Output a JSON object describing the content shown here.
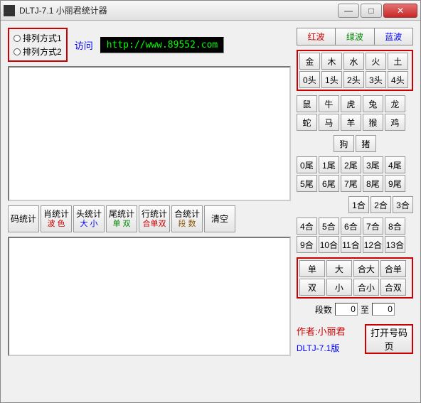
{
  "title": "DLTJ-7.1 小丽君统计器",
  "radios": {
    "opt1": "排列方式1",
    "opt2": "排列方式2"
  },
  "visit": "访问",
  "url": "http://www.89552.com",
  "stats": {
    "ma": "码统计",
    "xiao": {
      "t": "肖统计",
      "b": "波 色"
    },
    "tou": {
      "t": "头统计",
      "b": "大 小"
    },
    "wei": {
      "t": "尾统计",
      "b": "单 双"
    },
    "hang": {
      "t": "行统计",
      "b": "合单双"
    },
    "he": {
      "t": "合统计",
      "b": "段 数"
    },
    "clear": "清空"
  },
  "waves": {
    "red": "红波",
    "green": "绿波",
    "blue": "蓝波"
  },
  "elements": [
    "金",
    "木",
    "水",
    "火",
    "土"
  ],
  "heads": [
    "0头",
    "1头",
    "2头",
    "3头",
    "4头"
  ],
  "zodiac": [
    "鼠",
    "牛",
    "虎",
    "兔",
    "龙",
    "蛇",
    "马",
    "羊",
    "猴",
    "鸡",
    "狗",
    "猪"
  ],
  "tails": [
    "0尾",
    "1尾",
    "2尾",
    "3尾",
    "4尾",
    "5尾",
    "6尾",
    "7尾",
    "8尾",
    "9尾"
  ],
  "hebtns": [
    "1合",
    "2合",
    "3合",
    "4合",
    "5合",
    "6合",
    "7合",
    "8合",
    "9合",
    "10合",
    "11合",
    "12合",
    "13合"
  ],
  "combo": {
    "r1": [
      "单",
      "大",
      "合大",
      "合单"
    ],
    "r2": [
      "双",
      "小",
      "合小",
      "合双"
    ]
  },
  "range": {
    "label1": "段数",
    "val1": "0",
    "label2": "至",
    "val2": "0"
  },
  "footer": {
    "author": "作者:小丽君",
    "version": "DLTJ-7.1版",
    "open": "打开号码页"
  }
}
